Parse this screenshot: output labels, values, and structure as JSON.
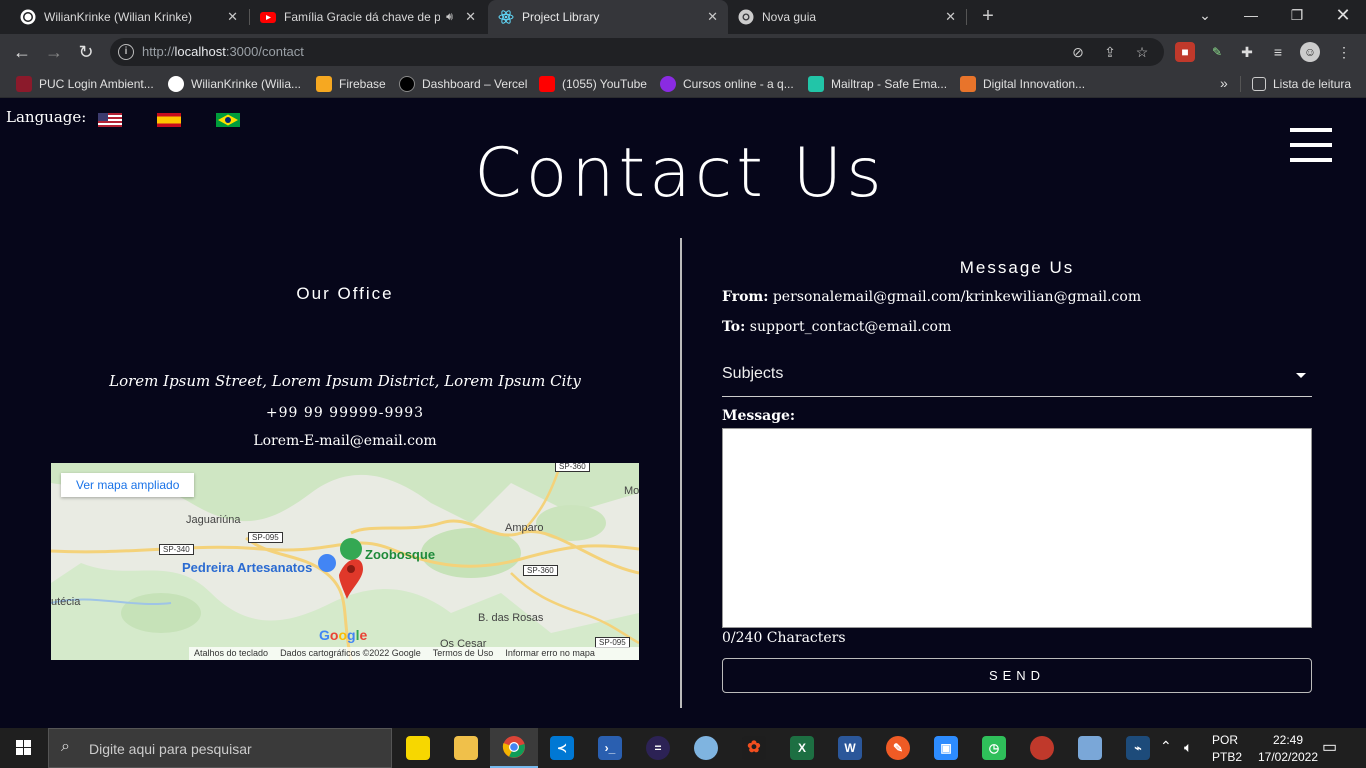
{
  "browser": {
    "tabs": [
      {
        "title": "WilianKrinke (Wilian Krinke)",
        "icon": "github-icon"
      },
      {
        "title": "Família Gracie dá chave de p",
        "icon": "youtube-icon"
      },
      {
        "title": "Project Library",
        "icon": "react-icon"
      },
      {
        "title": "Nova guia",
        "icon": "chrome-icon"
      }
    ],
    "url": {
      "scheme": "http://",
      "host": "localhost",
      "rest": ":3000/contact"
    },
    "bookmarks": [
      {
        "label": "PUC Login Ambient...",
        "color": "#8b1a2b"
      },
      {
        "label": "WilianKrinke (Wilia...",
        "color": "#ffffff"
      },
      {
        "label": "Firebase",
        "color": "#f6a821"
      },
      {
        "label": "Dashboard – Vercel",
        "color": "#000000"
      },
      {
        "label": "(1055) YouTube",
        "color": "#ff0000"
      },
      {
        "label": "Cursos online - a q...",
        "color": "#8a2be2"
      },
      {
        "label": "Mailtrap - Safe Ema...",
        "color": "#22c5a8"
      },
      {
        "label": "Digital Innovation...",
        "color": "#e8742b"
      }
    ],
    "reading_list": "Lista de leitura"
  },
  "page": {
    "language_label": "Language:",
    "title": "Contact Us",
    "office": {
      "title": "Our Office",
      "address": "Lorem Ipsum Street, Lorem Ipsum District, Lorem Ipsum City",
      "phone": "+99 99 99999-9993",
      "email": "Lorem-E-mail@email.com"
    },
    "map": {
      "larger_map": "Ver mapa ampliado",
      "labels": [
        "Jaguariúna",
        "Amparo",
        "B. das Rosas",
        "Os Cesar",
        "utécia",
        "Mo"
      ],
      "poi_pedreira": "Pedreira Artesanatos",
      "poi_zoo": "Zoobosque",
      "shields": [
        "SP-340",
        "SP-095",
        "SP-360",
        "SP-360",
        "SP-095"
      ],
      "footer": [
        "Atalhos do teclado",
        "Dados cartográficos ©2022 Google",
        "Termos de Uso",
        "Informar erro no mapa"
      ],
      "google": "Google"
    },
    "message": {
      "title": "Message Us",
      "from_label": "From:",
      "from_value": "personalemail@gmail.com/krinkewilian@gmail.com",
      "to_label": "To:",
      "to_value": "support_contact@email.com",
      "subjects": "Subjects",
      "message_label": "Message:",
      "char_count": "0/240 Characters",
      "send": "SEND"
    }
  },
  "taskbar": {
    "search_placeholder": "Digite aqui para pesquisar",
    "lang": "POR",
    "layout": "PTB2",
    "time": "22:49",
    "date": "17/02/2022"
  }
}
